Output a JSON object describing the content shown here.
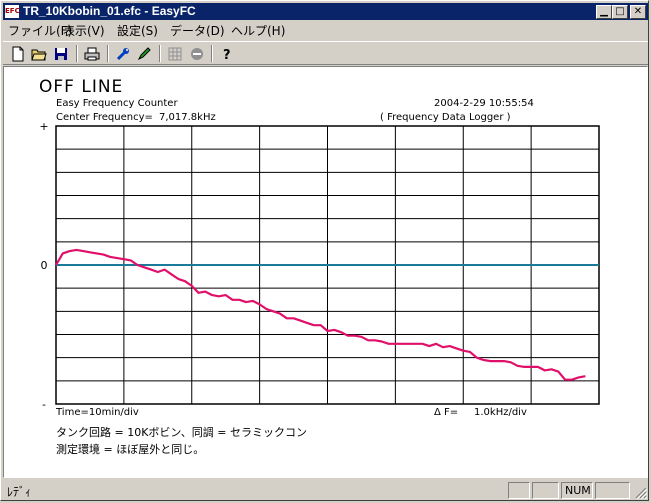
{
  "window": {
    "title": "TR_10Kbobin_01.efc - EasyFC",
    "icon_label": "EFC",
    "controls": [
      "minimize-icon",
      "maximize-icon",
      "close-icon"
    ]
  },
  "menu": [
    {
      "label": "ファイル(F)"
    },
    {
      "label": "表示(V)"
    },
    {
      "label": "設定(S)"
    },
    {
      "label": "データ(D)"
    },
    {
      "label": "ヘルプ(H)"
    }
  ],
  "toolbar": {
    "icons": [
      "new-file-icon",
      "open-folder-icon",
      "save-icon",
      "print-icon",
      "settings-wrench-icon",
      "pen-icon",
      "grid-disabled-icon",
      "stop-disabled-icon",
      "help-icon"
    ]
  },
  "screen": {
    "status_title": "OFF LINE",
    "app_name": "Easy Frequency Counter",
    "datetime": "2004-2-29  10:55:54",
    "center_label": "Center Frequency=",
    "center_value": "7,017.8kHz",
    "mode": "( Frequency Data Logger )",
    "time_div": "Time=10min/div",
    "delta_label": "Δ F=",
    "delta_value": "1.0kHz/div",
    "note1": "タンク回路 = 10Kボビン、同調 = セラミックコン",
    "note2": "測定環境 = ほぼ屋外と同じ。"
  },
  "chart_data": {
    "type": "line",
    "x_unit": "min",
    "y_unit": "kHz",
    "xlim": [
      0,
      80
    ],
    "ylim": [
      -6,
      6
    ],
    "y_tick_labels": [
      "+",
      "0",
      "-"
    ],
    "grid": true,
    "reference_line": 0,
    "line_color": "#e0106a",
    "reference_color": "#1a7a99",
    "series": [
      {
        "x": [
          0,
          1,
          2,
          3,
          4,
          5,
          6,
          7,
          8,
          9,
          10,
          11,
          12,
          13,
          14,
          15,
          16,
          17,
          18,
          19,
          20,
          21,
          22,
          23,
          24,
          25,
          26,
          27,
          28,
          29,
          30,
          31,
          32,
          33,
          34,
          35,
          36,
          37,
          38,
          39,
          40,
          41,
          42,
          43,
          44,
          45,
          46,
          47,
          48,
          49,
          50,
          51,
          52,
          53,
          54,
          55,
          56,
          57,
          58,
          59,
          60,
          61,
          62,
          63,
          64,
          65,
          66,
          67,
          68,
          69,
          70,
          71,
          72,
          73,
          74,
          75,
          76,
          77,
          78
        ],
        "y": [
          0.0,
          0.5,
          0.6,
          0.65,
          0.6,
          0.55,
          0.5,
          0.45,
          0.35,
          0.3,
          0.25,
          0.2,
          0.0,
          -0.1,
          -0.2,
          -0.3,
          -0.2,
          -0.4,
          -0.6,
          -0.7,
          -0.9,
          -1.2,
          -1.15,
          -1.3,
          -1.35,
          -1.3,
          -1.5,
          -1.5,
          -1.6,
          -1.55,
          -1.7,
          -1.9,
          -2.0,
          -2.1,
          -2.3,
          -2.3,
          -2.4,
          -2.5,
          -2.6,
          -2.6,
          -2.85,
          -2.8,
          -2.9,
          -3.05,
          -3.05,
          -3.1,
          -3.25,
          -3.25,
          -3.3,
          -3.4,
          -3.4,
          -3.4,
          -3.4,
          -3.4,
          -3.4,
          -3.5,
          -3.4,
          -3.55,
          -3.5,
          -3.6,
          -3.7,
          -3.75,
          -4.0,
          -4.1,
          -4.15,
          -4.15,
          -4.15,
          -4.2,
          -4.35,
          -4.4,
          -4.4,
          -4.4,
          -4.55,
          -4.5,
          -4.6,
          -4.95,
          -4.95,
          -4.85,
          -4.8
        ]
      }
    ]
  },
  "statusbar": {
    "text": "ﾚﾃﾞｨ",
    "num": "NUM"
  }
}
